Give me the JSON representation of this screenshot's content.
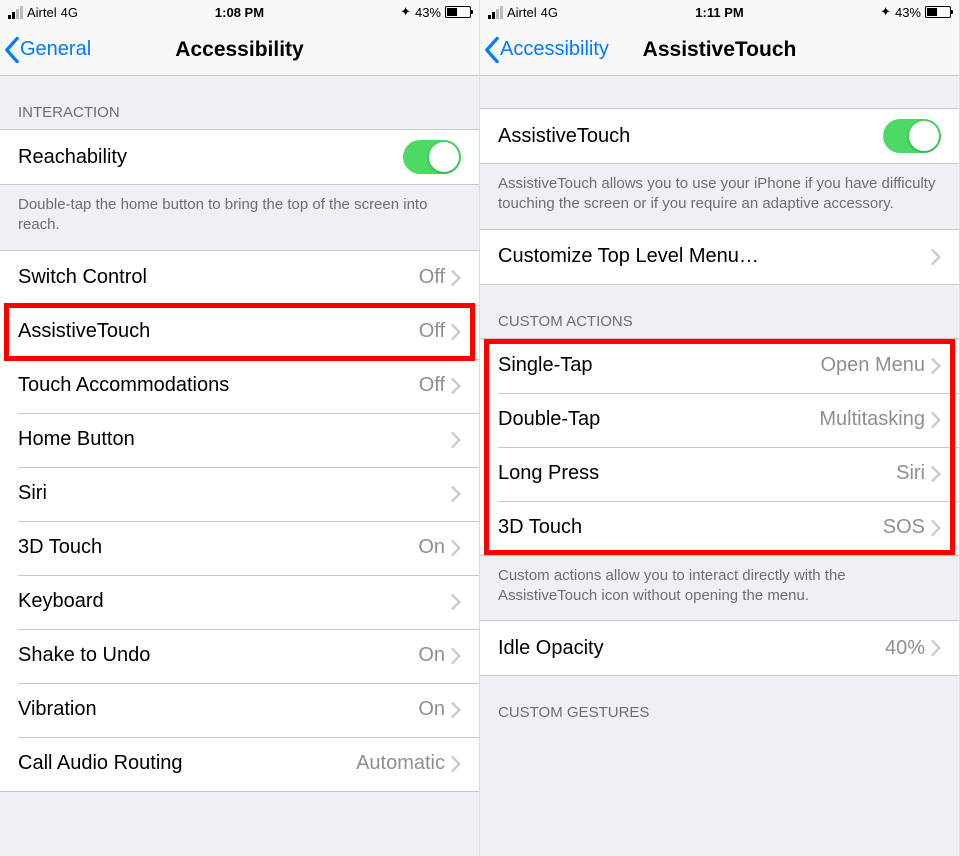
{
  "screens": [
    {
      "status": {
        "carrier": "Airtel",
        "network": "4G",
        "time": "1:08 PM",
        "battery_pct": "43%"
      },
      "nav": {
        "back": "General",
        "title": "Accessibility"
      },
      "section1_header": "INTERACTION",
      "reachability": {
        "label": "Reachability"
      },
      "reachability_footer": "Double-tap the home button to bring the top of the screen into reach.",
      "rows": [
        {
          "label": "Switch Control",
          "value": "Off"
        },
        {
          "label": "AssistiveTouch",
          "value": "Off",
          "highlight": true
        },
        {
          "label": "Touch Accommodations",
          "value": "Off"
        },
        {
          "label": "Home Button",
          "value": ""
        },
        {
          "label": "Siri",
          "value": ""
        },
        {
          "label": "3D Touch",
          "value": "On"
        },
        {
          "label": "Keyboard",
          "value": ""
        },
        {
          "label": "Shake to Undo",
          "value": "On"
        },
        {
          "label": "Vibration",
          "value": "On"
        },
        {
          "label": "Call Audio Routing",
          "value": "Automatic"
        }
      ]
    },
    {
      "status": {
        "carrier": "Airtel",
        "network": "4G",
        "time": "1:11 PM",
        "battery_pct": "43%"
      },
      "nav": {
        "back": "Accessibility",
        "title": "AssistiveTouch"
      },
      "at_toggle": {
        "label": "AssistiveTouch"
      },
      "at_footer": "AssistiveTouch allows you to use your iPhone if you have difficulty touching the screen or if you require an adaptive accessory.",
      "customize_label": "Customize Top Level Menu…",
      "custom_actions_header": "CUSTOM ACTIONS",
      "custom_actions": [
        {
          "label": "Single-Tap",
          "value": "Open Menu"
        },
        {
          "label": "Double-Tap",
          "value": "Multitasking"
        },
        {
          "label": "Long Press",
          "value": "Siri"
        },
        {
          "label": "3D Touch",
          "value": "SOS"
        }
      ],
      "custom_actions_footer": "Custom actions allow you to interact directly with the AssistiveTouch icon without opening the menu.",
      "idle_opacity": {
        "label": "Idle Opacity",
        "value": "40%"
      },
      "custom_gestures_header": "CUSTOM GESTURES"
    }
  ]
}
